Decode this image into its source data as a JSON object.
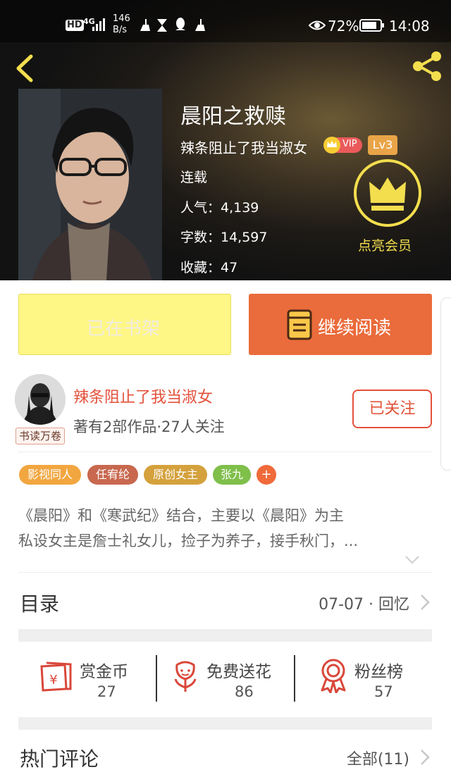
{
  "status_bar": {
    "hd": "HD",
    "signal": "4G",
    "speed_top": "146",
    "speed_bottom": "B/s",
    "battery": "72%",
    "time": "14:08"
  },
  "book": {
    "title": "晨阳之救赎",
    "author": "辣条阻止了我当淑女",
    "vip": "VIP",
    "level": "Lv3",
    "status": "连载",
    "popularity": "人气：4,139",
    "word_count": "字数：14,597",
    "favorites": "收藏：47"
  },
  "member": {
    "label": "点亮会员"
  },
  "actions": {
    "on_shelf": "已在书架",
    "continue_reading": "继续阅读"
  },
  "author_card": {
    "name": "辣条阻止了我当淑女",
    "stats": "著有2部作品·27人关注",
    "avatar_badge": "书读万卷",
    "follow": "已关注"
  },
  "tags": [
    {
      "label": "影视同人",
      "color": "#f2a640"
    },
    {
      "label": "任宥纶",
      "color": "#c8684f"
    },
    {
      "label": "原创女主",
      "color": "#d4a13c"
    },
    {
      "label": "张九",
      "color": "#7fbf4a"
    },
    {
      "label": "+",
      "color": "#f06a3a"
    }
  ],
  "synopsis": {
    "line1": "《晨阳》和《寒武纪》结合，主要以《晨阳》为主",
    "line2": "私设女主是詹士礼女儿，捡子为养子，接手秋门，..."
  },
  "catalog": {
    "title": "目录",
    "latest": "07-07 · 回忆"
  },
  "stats": [
    {
      "label": "赏金币",
      "value": "27",
      "icon": "red-envelope-icon"
    },
    {
      "label": "免费送花",
      "value": "86",
      "icon": "flower-icon"
    },
    {
      "label": "粉丝榜",
      "value": "57",
      "icon": "medal-icon"
    }
  ],
  "comments": {
    "title": "热门评论",
    "all": "全部(11)"
  }
}
